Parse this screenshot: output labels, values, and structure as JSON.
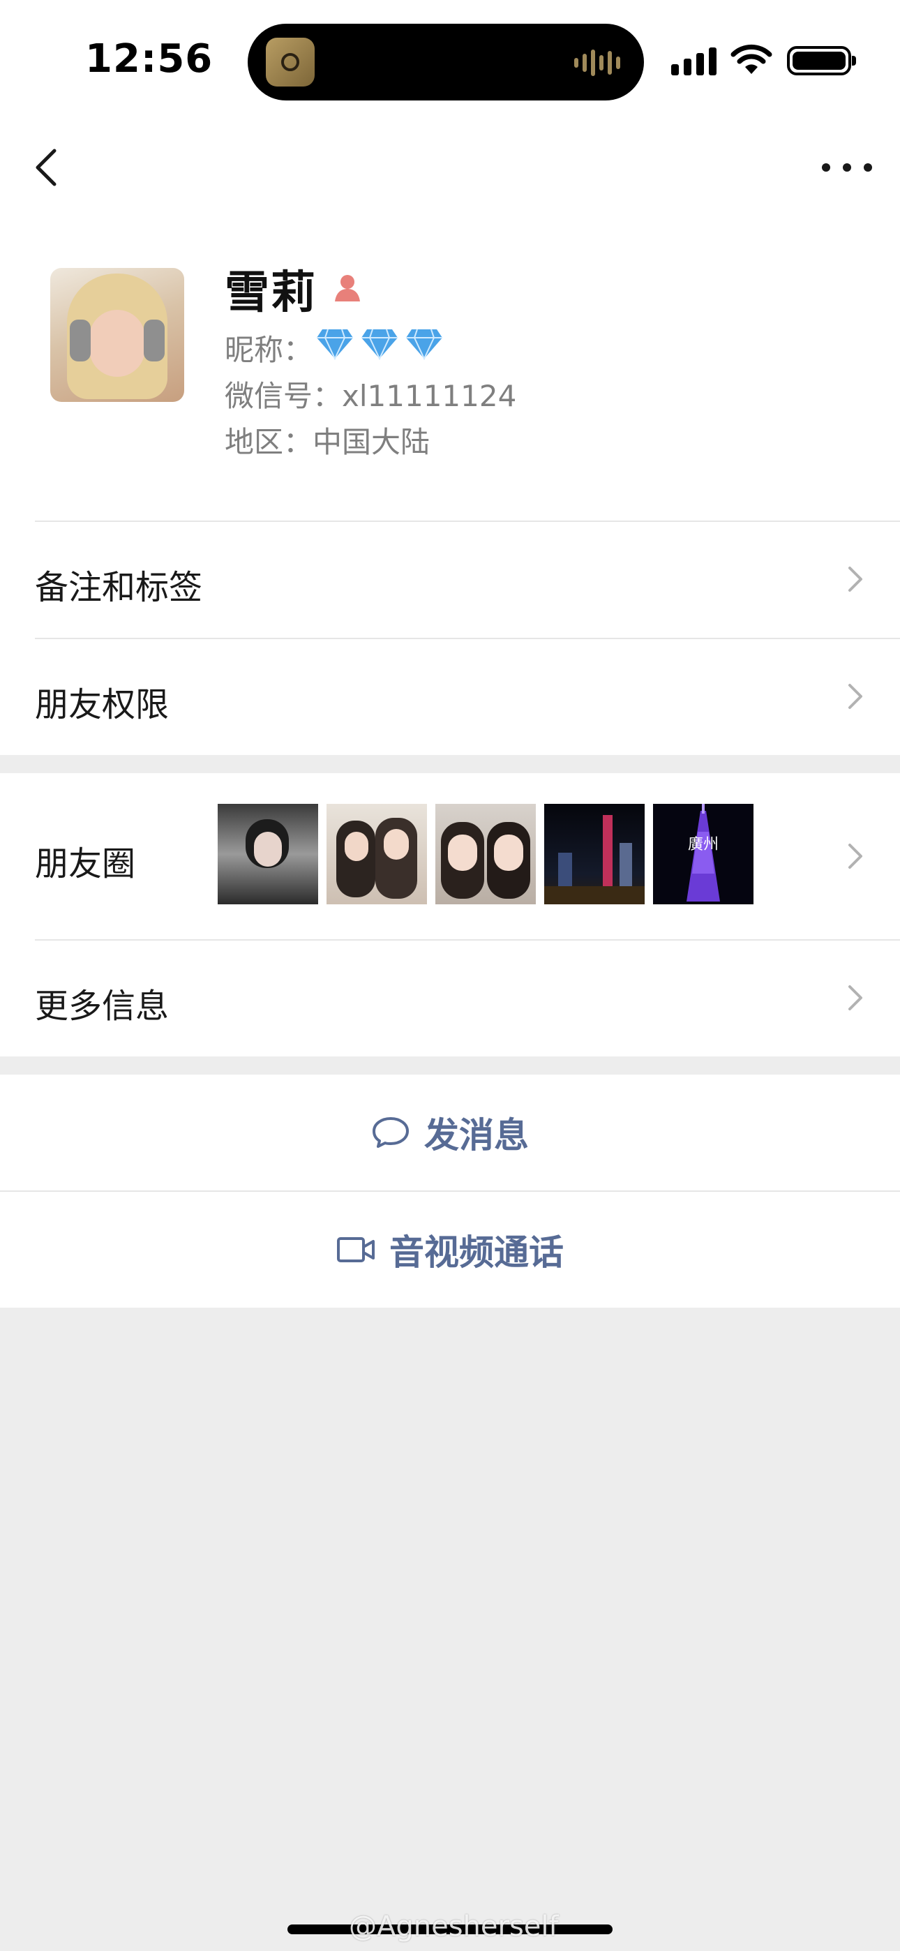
{
  "status_bar": {
    "time": "12:56"
  },
  "profile": {
    "name": "雪莉",
    "nickname_label": "昵称：",
    "wechat_id_label": "微信号：",
    "wechat_id": "xl11111124",
    "region_label": "地区：",
    "region": "中国大陆"
  },
  "rows": {
    "remarks": "备注和标签",
    "permissions": "朋友权限",
    "moments": "朋友圈",
    "more_info": "更多信息"
  },
  "moments_thumbnails": [
    {
      "caption": ""
    },
    {
      "caption": ""
    },
    {
      "caption": ""
    },
    {
      "caption": ""
    },
    {
      "caption": "廣州"
    }
  ],
  "actions": {
    "message": "发消息",
    "call": "音视频通话"
  },
  "watermark": "@Agnesherself",
  "colors": {
    "link": "#576b95",
    "background": "#ededed",
    "gender_female": "#e8807a"
  }
}
